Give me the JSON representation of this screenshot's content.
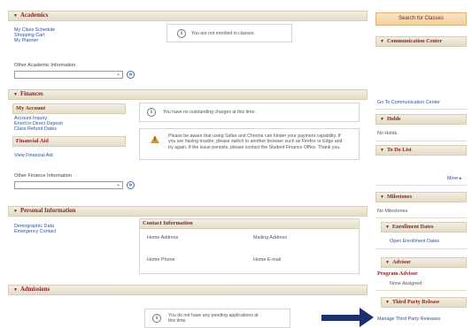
{
  "academics": {
    "header": "Academics",
    "links": [
      "My Class Schedule",
      "Shopping Cart",
      "My Planner"
    ],
    "enroll_message": "You are not enrolled in classes.",
    "other_label": "Other Academic Information",
    "other_value": ""
  },
  "finances": {
    "header": "Finances",
    "my_account": {
      "title": "My Account",
      "links": [
        "Account Inquiry",
        "Enroll in Direct Deposit",
        "Class Refund Dates"
      ]
    },
    "charges_message": "You have no outstanding charges at this time.",
    "warning_message": "Please be aware that using Safari and Chrome can hinder your payment capability. If you are having trouble, please switch to another browser such as Firefox or Edge and try again. If the issue persists, please contact the Student Finance Office. Thank you.",
    "financial_aid": {
      "title": "Financial Aid",
      "link": "View Financial Aid"
    },
    "other_label": "Other Finance Information",
    "other_value": ""
  },
  "personal": {
    "header": "Personal Information",
    "links": [
      "Demographic Data",
      "Emergency Contact"
    ],
    "contact": {
      "title": "Contact Information",
      "home_address": "Home Address",
      "mailing_address": "Mailing Address",
      "home_phone": "Home Phone",
      "home_email": "Home E-mail"
    }
  },
  "admissions": {
    "header": "Admissions",
    "message": "You do not have any pending applications at this time."
  },
  "sidebar": {
    "search_button": "Search for Classes",
    "communication": {
      "header": "Communication Center",
      "link": "Go To Communication Center"
    },
    "holds": {
      "header": "Holds",
      "text": "No Holds."
    },
    "todo": {
      "header": "To Do List",
      "more": "More"
    },
    "milestones": {
      "header": "Milestones",
      "text": "No Milestones"
    },
    "enrollment_dates": {
      "header": "Enrollment Dates",
      "link": "Open Enrollment Dates"
    },
    "advisor": {
      "header": "Advisor",
      "program_advisor": "Program Advisor",
      "value": "None Assigned"
    },
    "third_party": {
      "header": "Third Party Release",
      "link": "Manage Third Party Releases"
    }
  },
  "colors": {
    "section_header_text": "#8b2323",
    "link": "#2d52a0",
    "annotation_arrow": "#1c2f6e"
  }
}
